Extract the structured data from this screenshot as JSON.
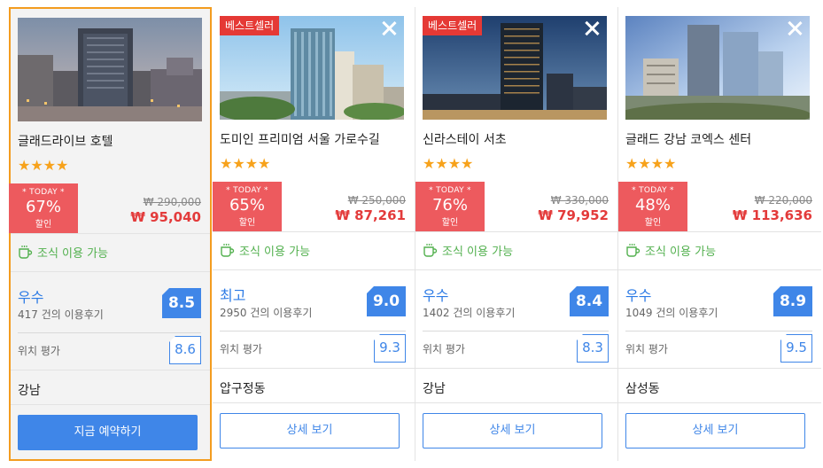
{
  "hotels": [
    {
      "name": "글래드라이브 호텔",
      "stars": "★★★★",
      "badge": "",
      "today": "* TODAY *",
      "discount": "67%",
      "discount_label": "할인",
      "original_price": "₩ 290,000",
      "price": "₩ 95,040",
      "breakfast": "조식 이용 가능",
      "grade": "우수",
      "reviews": "417 건의 이용후기",
      "score": "8.5",
      "location_label": "위치 평가",
      "location_score": "8.6",
      "area": "강남",
      "button": "지금 예약하기"
    },
    {
      "name": "도미인 프리미엄 서울 가로수길",
      "stars": "★★★★",
      "badge": "베스트셀러",
      "today": "* TODAY *",
      "discount": "65%",
      "discount_label": "할인",
      "original_price": "₩ 250,000",
      "price": "₩ 87,261",
      "breakfast": "조식 이용 가능",
      "grade": "최고",
      "reviews": "2950 건의 이용후기",
      "score": "9.0",
      "location_label": "위치 평가",
      "location_score": "9.3",
      "area": "압구정동",
      "button": "상세 보기"
    },
    {
      "name": "신라스테이 서초",
      "stars": "★★★★",
      "badge": "베스트셀러",
      "today": "* TODAY *",
      "discount": "76%",
      "discount_label": "할인",
      "original_price": "₩ 330,000",
      "price": "₩ 79,952",
      "breakfast": "조식 이용 가능",
      "grade": "우수",
      "reviews": "1402 건의 이용후기",
      "score": "8.4",
      "location_label": "위치 평가",
      "location_score": "8.3",
      "area": "강남",
      "button": "상세 보기"
    },
    {
      "name": "글래드 강남 코엑스 센터",
      "stars": "★★★★",
      "badge": "",
      "today": "* TODAY *",
      "discount": "48%",
      "discount_label": "할인",
      "original_price": "₩ 220,000",
      "price": "₩ 113,636",
      "breakfast": "조식 이용 가능",
      "grade": "우수",
      "reviews": "1049 건의 이용후기",
      "score": "8.9",
      "location_label": "위치 평가",
      "location_score": "9.5",
      "area": "삼성동",
      "button": "상세 보기"
    }
  ],
  "colors": {
    "accent": "#3f86e8",
    "discount": "#ed5a5e",
    "price": "#e33b3b",
    "breakfast": "#52b04e",
    "selected_border": "#f39c1f",
    "star": "#f7a21b",
    "badge": "#e53935"
  }
}
